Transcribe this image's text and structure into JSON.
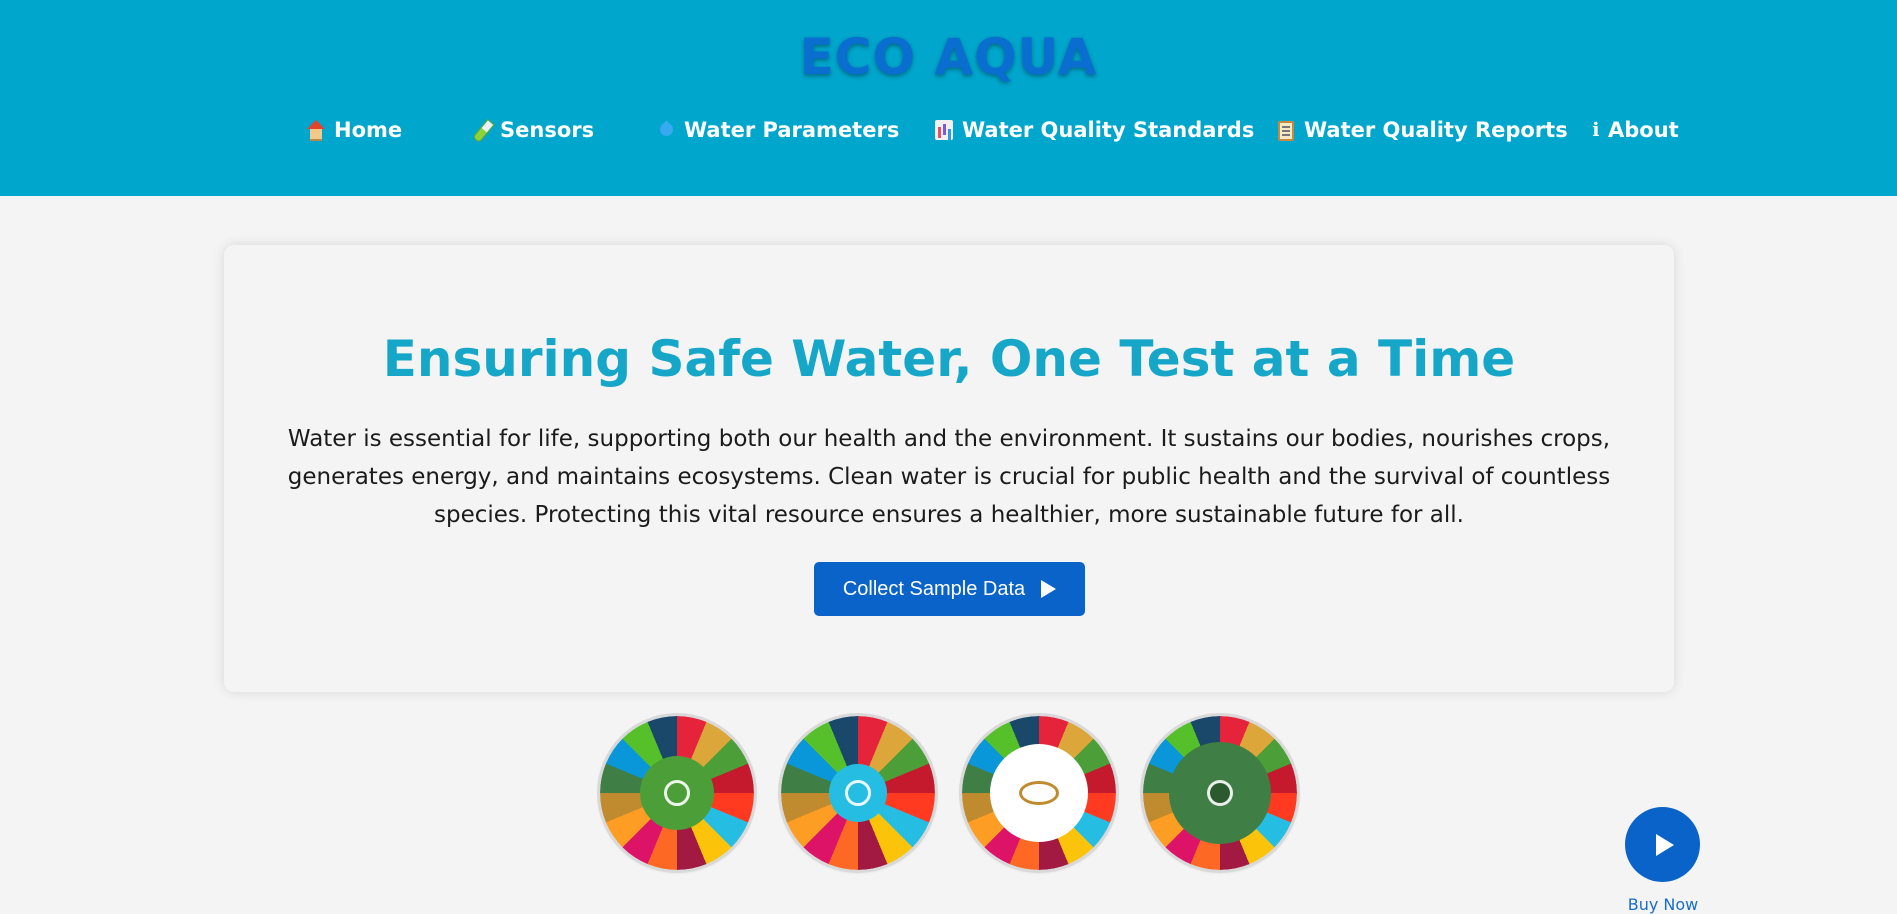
{
  "brand": {
    "name": "ECO AQUA"
  },
  "nav": {
    "items": [
      {
        "label": "Home",
        "icon": "house-icon"
      },
      {
        "label": "Sensors",
        "icon": "test-tube-icon"
      },
      {
        "label": "Water Parameters",
        "icon": "droplet-icon"
      },
      {
        "label": "Water Quality Standards",
        "icon": "bar-chart-icon"
      },
      {
        "label": "Water Quality Reports",
        "icon": "clipboard-icon"
      },
      {
        "label": "About",
        "icon": "info-icon"
      }
    ],
    "info_glyph": "ℹ"
  },
  "hero": {
    "title": "Ensuring Safe Water, One Test at a Time",
    "description": "Water is essential for life, supporting both our health and the environment. It sustains our bodies, nourishes crops, generates energy, and maintains ecosystems. Clean water is crucial for public health and the survival of countless species. Protecting this vital resource ensures a healthier, more sustainable future for all.",
    "cta_label": "Collect Sample Data"
  },
  "sdg_wheels": [
    {
      "name": "sdg-goal-3-wheel",
      "center_color": "#4c9f38"
    },
    {
      "name": "sdg-goal-6-wheel",
      "center_color": "#26bde2"
    },
    {
      "name": "sdg-goal-12-wheel",
      "center_color": "#ffffff"
    },
    {
      "name": "sdg-goal-13-wheel",
      "center_color": "#3f7e44"
    }
  ],
  "floating": {
    "buy_label": "Buy Now"
  },
  "colors": {
    "header_bg": "#00a6cc",
    "brand": "#0a6ed1",
    "title": "#16a6c8",
    "button": "#0a63c9",
    "page_bg": "#f4f4f4"
  }
}
